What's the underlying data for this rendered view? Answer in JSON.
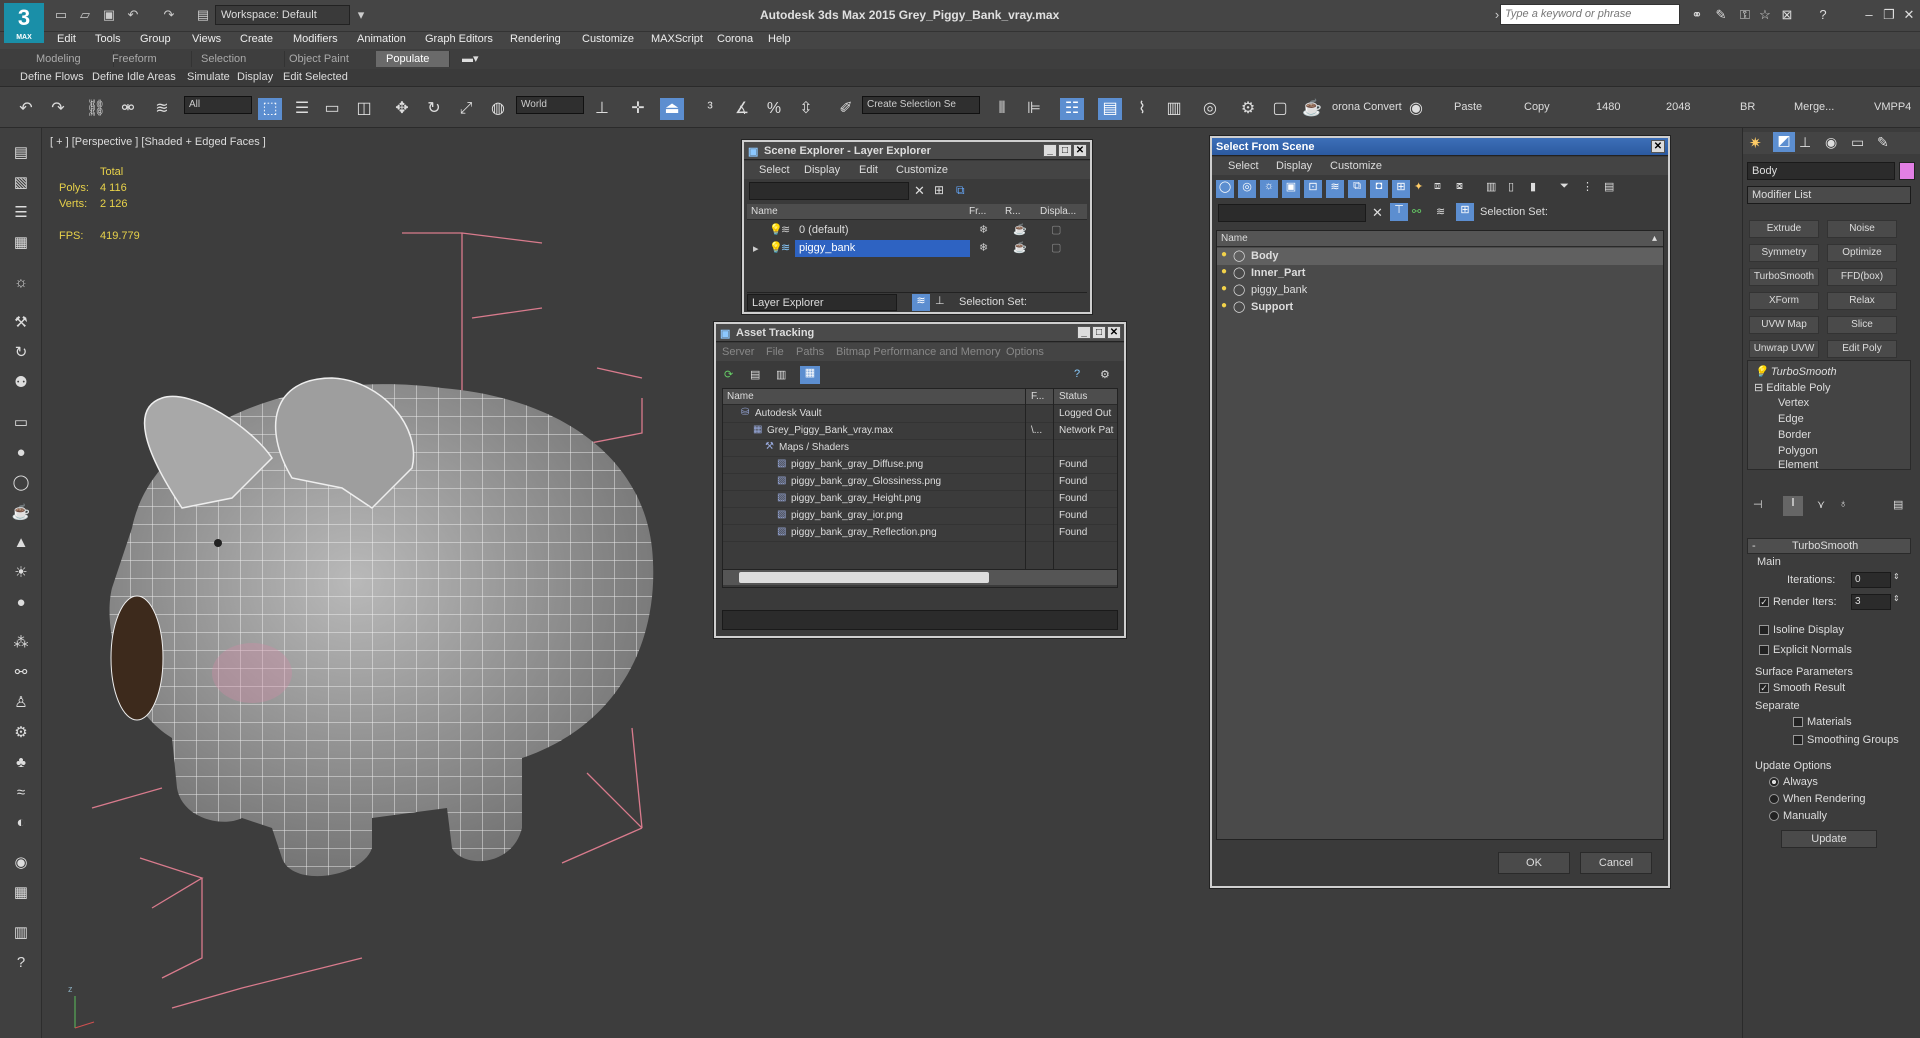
{
  "app": {
    "title": "Autodesk 3ds Max 2015     Grey_Piggy_Bank_vray.max",
    "logo_text": "3",
    "logo_sub": "MAX",
    "workspace": "Workspace: Default",
    "search_placeholder": "Type a keyword or phrase"
  },
  "menu": [
    "Edit",
    "Tools",
    "Group",
    "Views",
    "Create",
    "Modifiers",
    "Animation",
    "Graph Editors",
    "Rendering",
    "Customize",
    "MAXScript",
    "Corona",
    "Help"
  ],
  "ribbon_tabs": [
    "Modeling",
    "Freeform",
    "Selection",
    "Object Paint",
    "Populate"
  ],
  "ribbon_active": "Populate",
  "ribbon_sub": [
    "Define Flows",
    "Define Idle Areas",
    "Simulate",
    "Display",
    "Edit Selected"
  ],
  "toolbar": {
    "filter": "All",
    "coord": "World",
    "selection_set_placeholder": "Create Selection Se",
    "corona_convert": "orona Convert",
    "paste": "Paste",
    "copy": "Copy",
    "w1480": "1480",
    "w2048": "2048",
    "br": "BR",
    "merge": "Merge...",
    "vmpp": "VMPP4"
  },
  "viewport": {
    "label": "[ + ] [Perspective ] [Shaded + Edged Faces ]",
    "total": "Total",
    "polys_label": "Polys:",
    "polys": "4 116",
    "verts_label": "Verts:",
    "verts": "2 126",
    "fps_label": "FPS:",
    "fps": "419.779"
  },
  "scene_explorer": {
    "title": "Scene Explorer - Layer Explorer",
    "menu": [
      "Select",
      "Display",
      "Edit",
      "Customize"
    ],
    "columns": [
      "Name",
      "Fr...",
      "R...",
      "Displa..."
    ],
    "rows": [
      {
        "name": "0 (default)",
        "selected": false
      },
      {
        "name": "piggy_bank",
        "selected": true
      }
    ],
    "footer_mode": "Layer Explorer",
    "footer_set": "Selection Set:"
  },
  "asset_tracking": {
    "title": "Asset Tracking",
    "menu": [
      "Server",
      "File",
      "Paths",
      "Bitmap Performance and Memory",
      "Options"
    ],
    "columns": [
      "Name",
      "F...",
      "Status"
    ],
    "rows": [
      {
        "name": "Autodesk Vault",
        "f": "",
        "status": "Logged Out",
        "indent": 1
      },
      {
        "name": "Grey_Piggy_Bank_vray.max",
        "f": "\\...",
        "status": "Network Pat",
        "indent": 2
      },
      {
        "name": "Maps / Shaders",
        "f": "",
        "status": "",
        "indent": 3
      },
      {
        "name": "piggy_bank_gray_Diffuse.png",
        "f": "",
        "status": "Found",
        "indent": 4
      },
      {
        "name": "piggy_bank_gray_Glossiness.png",
        "f": "",
        "status": "Found",
        "indent": 4
      },
      {
        "name": "piggy_bank_gray_Height.png",
        "f": "",
        "status": "Found",
        "indent": 4
      },
      {
        "name": "piggy_bank_gray_ior.png",
        "f": "",
        "status": "Found",
        "indent": 4
      },
      {
        "name": "piggy_bank_gray_Reflection.png",
        "f": "",
        "status": "Found",
        "indent": 4
      }
    ]
  },
  "select_from_scene": {
    "title": "Select From Scene",
    "menu": [
      "Select",
      "Display",
      "Customize"
    ],
    "selection_set": "Selection Set:",
    "column": "Name",
    "rows": [
      {
        "name": "Body",
        "bold": true
      },
      {
        "name": "Inner_Part",
        "bold": true
      },
      {
        "name": "piggy_bank",
        "bold": false
      },
      {
        "name": "Support",
        "bold": true
      }
    ],
    "ok": "OK",
    "cancel": "Cancel"
  },
  "command_panel": {
    "object_name": "Body",
    "modifier_list": "Modifier List",
    "buttons": [
      [
        "Extrude",
        "Noise"
      ],
      [
        "Symmetry",
        "Optimize"
      ],
      [
        "TurboSmooth",
        "FFD(box)"
      ],
      [
        "XForm",
        "Relax"
      ],
      [
        "UVW Map",
        "Slice"
      ],
      [
        "Unwrap UVW",
        "Edit Poly"
      ]
    ],
    "stack": [
      "TurboSmooth",
      "Editable Poly",
      "Vertex",
      "Edge",
      "Border",
      "Polygon",
      "Element"
    ],
    "rollout_title": "TurboSmooth",
    "main_label": "Main",
    "iterations_label": "Iterations:",
    "iterations": "0",
    "render_iters_label": "Render Iters:",
    "render_iters": "3",
    "isoline": "Isoline Display",
    "explicit": "Explicit Normals",
    "surface_params": "Surface Parameters",
    "smooth_result": "Smooth Result",
    "separate": "Separate",
    "materials": "Materials",
    "smoothing_groups": "Smoothing Groups",
    "update_options": "Update Options",
    "always": "Always",
    "when_rendering": "When Rendering",
    "manually": "Manually",
    "update": "Update"
  }
}
